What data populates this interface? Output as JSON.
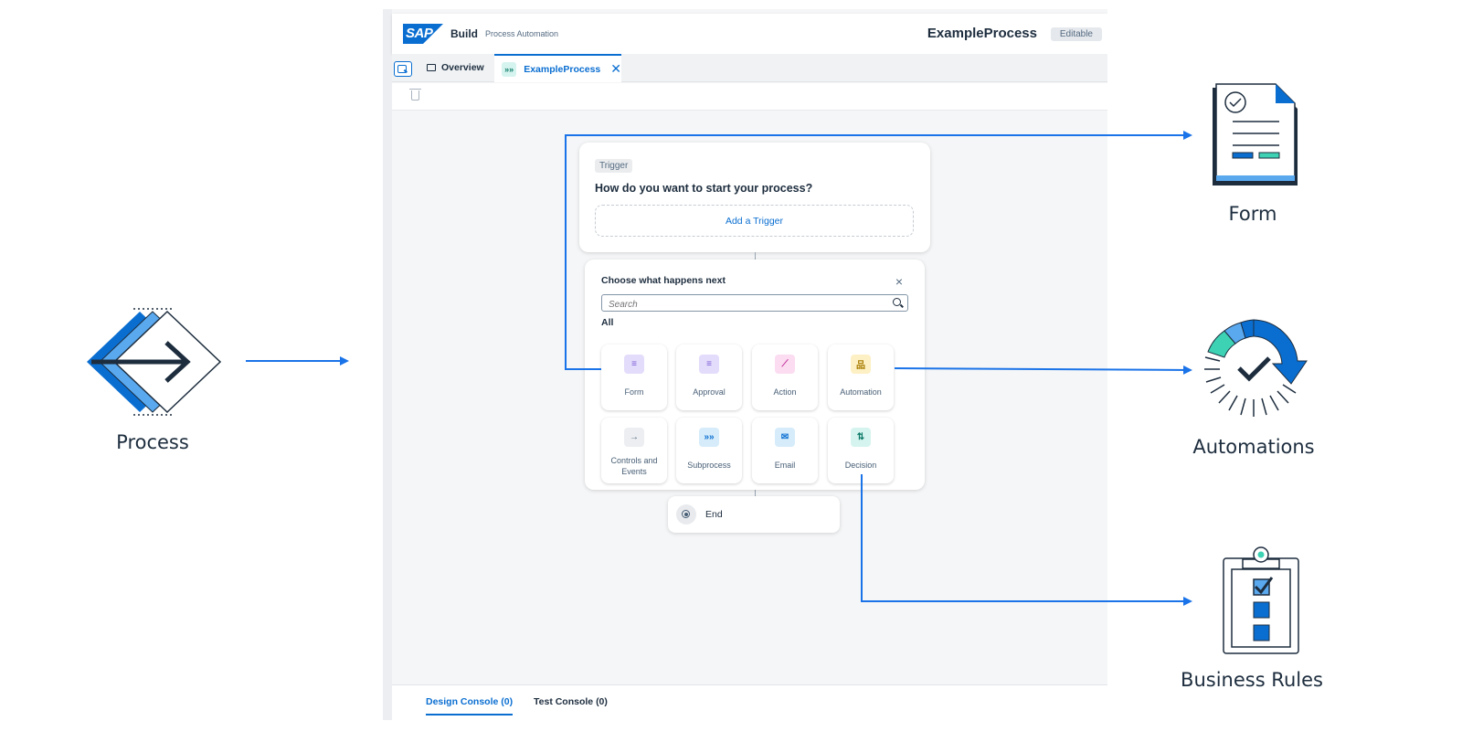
{
  "app": {
    "brand_logo_text": "SAP",
    "brand_name": "Build",
    "brand_product": "Process Automation",
    "process_name": "ExampleProcess",
    "process_status": "Editable"
  },
  "tabs": {
    "overview_label": "Overview",
    "active_label": "ExampleProcess",
    "active_badge": "»»"
  },
  "trigger": {
    "badge": "Trigger",
    "question": "How do you want to start your process?",
    "add_label": "Add a Trigger"
  },
  "chooser": {
    "title": "Choose what happens next",
    "close": "×",
    "search_placeholder": "Search",
    "section_label": "All",
    "tiles": [
      {
        "label": "Form",
        "glyph": "≡",
        "icon": "form-icon",
        "bg": "#e4dcfb",
        "fg": "#7b5cd6"
      },
      {
        "label": "Approval",
        "glyph": "≡",
        "icon": "approval-icon",
        "bg": "#e4dcfb",
        "fg": "#7b5cd6"
      },
      {
        "label": "Action",
        "glyph": "⟋",
        "icon": "action-icon",
        "bg": "#fbdcf1",
        "fg": "#c2309a"
      },
      {
        "label": "Automation",
        "glyph": "品",
        "icon": "automation-icon",
        "bg": "#fdf0c4",
        "fg": "#a87b00"
      },
      {
        "label": "Controls and Events",
        "glyph": "→",
        "icon": "controls-events-icon",
        "bg": "#eceef1",
        "fg": "#556b82"
      },
      {
        "label": "Subprocess",
        "glyph": "»»",
        "icon": "subprocess-icon",
        "bg": "#d6ecfa",
        "fg": "#0a6ed1"
      },
      {
        "label": "Email",
        "glyph": "✉",
        "icon": "email-icon",
        "bg": "#d6ecfa",
        "fg": "#0a6ed1"
      },
      {
        "label": "Decision",
        "glyph": "⇅",
        "icon": "decision-icon",
        "bg": "#d6f4ef",
        "fg": "#0f7c6a"
      }
    ]
  },
  "end_node": {
    "label": "End"
  },
  "console": {
    "design_tab": "Design Console (0)",
    "test_tab": "Test Console (0)"
  },
  "artifacts": {
    "process_label": "Process",
    "form_label": "Form",
    "automations_label": "Automations",
    "business_rules_label": "Business Rules"
  },
  "colors": {
    "accent": "#0a6ed1",
    "arrow": "#1a73e8",
    "dark": "#1d2d3e",
    "teal": "#3dd2b4"
  }
}
